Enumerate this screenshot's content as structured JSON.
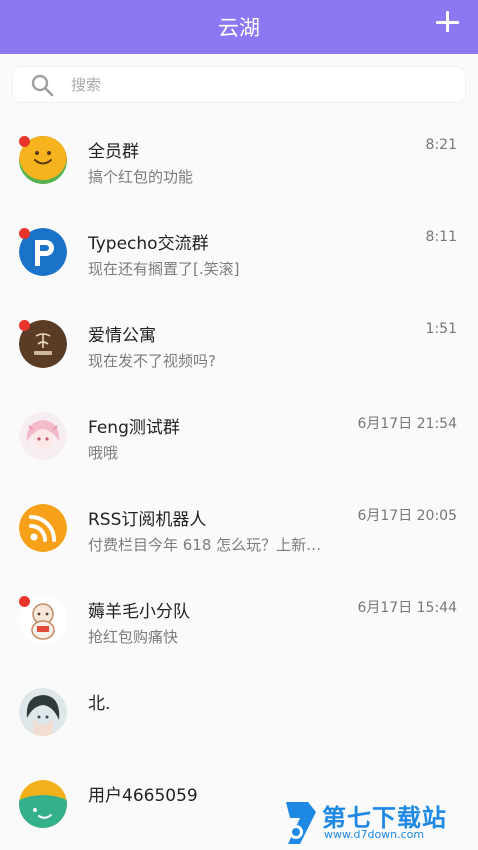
{
  "header": {
    "title": "云湖",
    "add_icon": "plus-icon"
  },
  "search": {
    "placeholder": "搜索",
    "icon": "search-icon"
  },
  "conversations": [
    {
      "name": "全员群",
      "message": "搞个红包的功能",
      "time": "8:21",
      "unread": true
    },
    {
      "name": "Typecho交流群",
      "message": "现在还有搁置了[.笑滚]",
      "time": "8:11",
      "unread": true
    },
    {
      "name": "爱情公寓",
      "message": "现在发不了视频吗?",
      "time": "1:51",
      "unread": true,
      "avatar_text": "爱情公寓"
    },
    {
      "name": "Feng测试群",
      "message": "哦哦",
      "time": "6月17日 21:54",
      "unread": false
    },
    {
      "name": "RSS订阅机器人",
      "message": "付费栏目今年 618 怎么玩？上新…",
      "time": "6月17日 20:05",
      "unread": false
    },
    {
      "name": "薅羊毛小分队",
      "message": "抢红包购痛快",
      "time": "6月17日 15:44",
      "unread": true
    },
    {
      "name": "北.",
      "message": "",
      "time": "",
      "unread": false
    },
    {
      "name": "用户4665059",
      "message": "",
      "time": "",
      "unread": false
    }
  ],
  "watermark": {
    "brand": "第七下载站",
    "url": "www.d7down.com"
  },
  "colors": {
    "header": "#8c78f2",
    "unread_dot": "#e8352c",
    "rss": "#f7a11a"
  }
}
